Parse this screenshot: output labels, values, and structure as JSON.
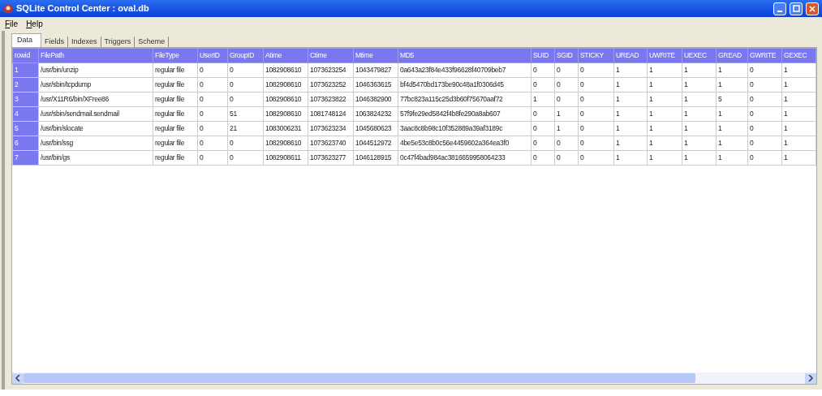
{
  "window": {
    "title": "SQLite Control Center : oval.db"
  },
  "menu": [
    "File",
    "Help"
  ],
  "tabs": [
    {
      "label": "Data",
      "selected": true
    },
    {
      "label": "Fields",
      "selected": false
    },
    {
      "label": "Indexes",
      "selected": false
    },
    {
      "label": "Triggers",
      "selected": false
    },
    {
      "label": "Scheme",
      "selected": false
    }
  ],
  "table": {
    "columns": [
      "rowid",
      "FilePath",
      "FileType",
      "UserID",
      "GroupID",
      "Atime",
      "Ctime",
      "Mtime",
      "MD5",
      "SUID",
      "SGID",
      "STICKY",
      "UREAD",
      "UWRITE",
      "UEXEC",
      "GREAD",
      "GWRITE",
      "GEXEC"
    ],
    "rows": [
      [
        "1",
        "/usr/bin/unzip",
        "regular file",
        "0",
        "0",
        "1082908610",
        "1073623254",
        "1043479827",
        "0a643a23f84e433f96628f40709beb7",
        "0",
        "0",
        "0",
        "1",
        "1",
        "1",
        "1",
        "0",
        "1"
      ],
      [
        "2",
        "/usr/sbin/tcpdump",
        "regular file",
        "0",
        "0",
        "1082908610",
        "1073623252",
        "1046363615",
        "bf4d5470bd173be90c48a1f0306d45",
        "0",
        "0",
        "0",
        "1",
        "1",
        "1",
        "1",
        "0",
        "1"
      ],
      [
        "3",
        "/usr/X11R6/bin/XFree86",
        "regular file",
        "0",
        "0",
        "1082908610",
        "1073623822",
        "1046382900",
        "77bc823a115c25d3b60f75670aaf72",
        "1",
        "0",
        "0",
        "1",
        "1",
        "1",
        "5",
        "0",
        "1"
      ],
      [
        "4",
        "/usr/sbin/sendmail.sendmail",
        "regular file",
        "0",
        "51",
        "1082908610",
        "1081748124",
        "1063824232",
        "57f9fe29ed5842f4b8fe290a8ab607",
        "0",
        "1",
        "0",
        "1",
        "1",
        "1",
        "1",
        "0",
        "1"
      ],
      [
        "5",
        "/usr/bin/slocate",
        "regular file",
        "0",
        "21",
        "1083006231",
        "1073623234",
        "1045680623",
        "3aac8c8b98c10f352889a39af3189c",
        "0",
        "1",
        "0",
        "1",
        "1",
        "1",
        "1",
        "0",
        "1"
      ],
      [
        "6",
        "/usr/bin/ssg",
        "regular file",
        "0",
        "0",
        "1082908610",
        "1073623740",
        "1044512972",
        "4be5e53c8b0c56e4459602a364ea3f0",
        "0",
        "0",
        "0",
        "1",
        "1",
        "1",
        "1",
        "0",
        "1"
      ],
      [
        "7",
        "/usr/bin/gs",
        "regular file",
        "0",
        "0",
        "1082908611",
        "1073623277",
        "1046128915",
        "0c47f4bad984ac3816659958064233",
        "0",
        "0",
        "0",
        "1",
        "1",
        "1",
        "1",
        "0",
        "1"
      ]
    ]
  }
}
